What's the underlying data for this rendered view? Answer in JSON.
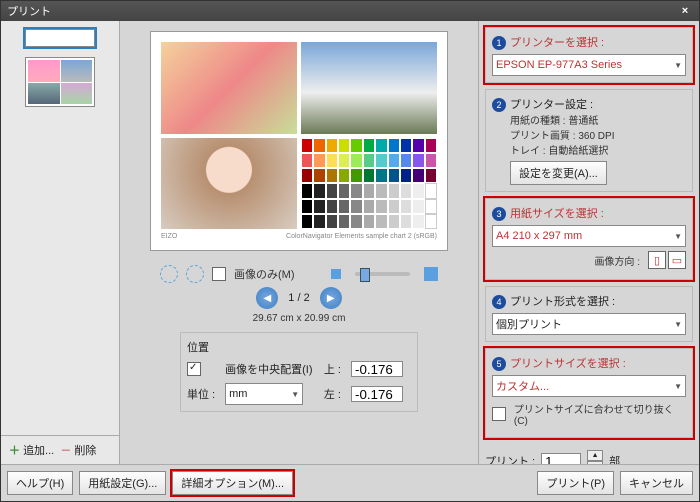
{
  "window": {
    "title": "プリント",
    "close": "×"
  },
  "left": {
    "add": "追加...",
    "remove": "削除"
  },
  "center": {
    "preview_footer_left": "EIZO",
    "preview_footer_right": "ColorNavigator Elements sample chart 2 (sRGB)",
    "rotate_label": "画像のみ(M)",
    "page": "1 / 2",
    "dims": "29.67 cm x 20.99 cm",
    "position": {
      "title": "位置",
      "center_label": "画像を中央配置(I)",
      "unit_label": "単位 :",
      "unit_value": "mm",
      "top_label": "上 :",
      "top_value": "-0.176",
      "left_label": "左 :",
      "left_value": "-0.176"
    }
  },
  "right": {
    "s1": {
      "title": "プリンターを選択 :",
      "value": "EPSON EP-977A3 Series"
    },
    "s2": {
      "title": "プリンター設定 :",
      "l1": "用紙の種類 :",
      "v1": "普通紙",
      "l2": "プリント画質 :",
      "v2": "360 DPI",
      "l3": "トレイ :",
      "v3": "自動給紙選択",
      "btn": "設定を変更(A)..."
    },
    "s3": {
      "title": "用紙サイズを選択 :",
      "value": "A4 210 x 297 mm",
      "orient_label": "画像方向 :"
    },
    "s4": {
      "title": "プリント形式を選択 :",
      "value": "個別プリント"
    },
    "s5": {
      "title": "プリントサイズを選択 :",
      "value": "カスタム...",
      "fit": "プリントサイズに合わせて切り抜く(C)"
    },
    "copies_label": "プリント :",
    "copies_value": "1",
    "copies_unit": "部"
  },
  "bottom": {
    "help": "ヘルプ(H)",
    "paper": "用紙設定(G)...",
    "adv": "詳細オプション(M)...",
    "print": "プリント(P)",
    "cancel": "キャンセル"
  }
}
